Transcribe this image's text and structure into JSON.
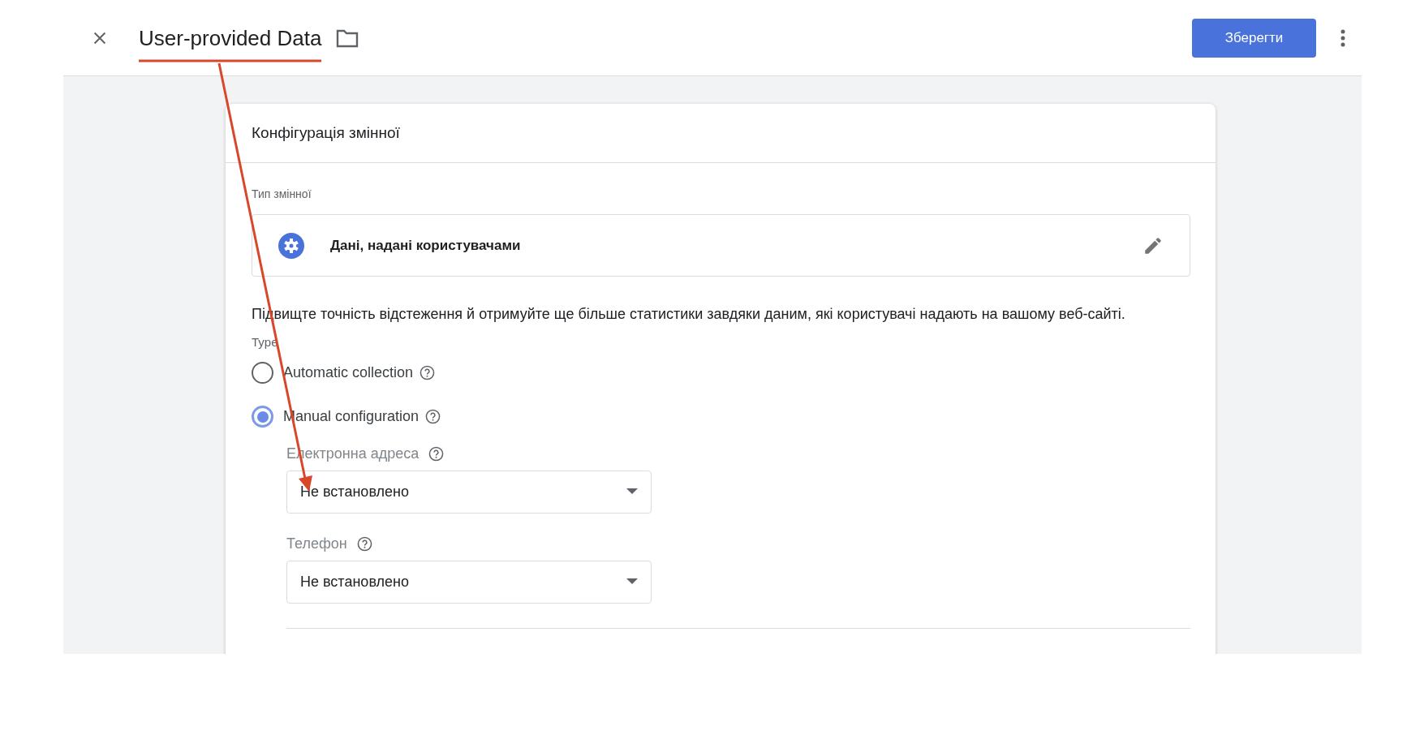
{
  "header": {
    "title": "User-provided Data",
    "save_button": "Зберегти"
  },
  "card": {
    "title": "Конфігурація змінної",
    "variable_type_label": "Тип змінної",
    "variable_type": "Дані, надані користувачами",
    "description": "Підвищте точність відстеження й отримуйте ще більше статистики завдяки даним, які користувачі надають на вашому веб-сайті.",
    "type_label": "Type",
    "options": [
      {
        "label": "Automatic collection",
        "selected": false
      },
      {
        "label": "Manual configuration",
        "selected": true
      }
    ],
    "fields": [
      {
        "label": "Електронна адреса",
        "value": "Не встановлено"
      },
      {
        "label": "Телефон",
        "value": "Не встановлено"
      }
    ]
  }
}
